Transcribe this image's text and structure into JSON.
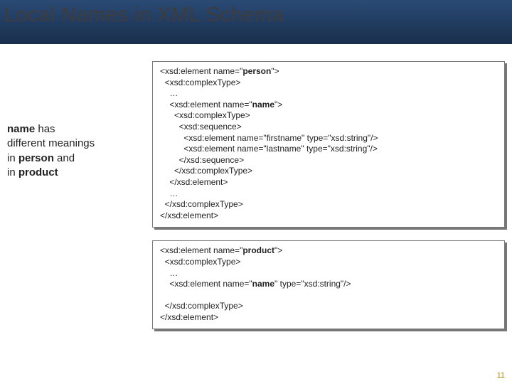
{
  "title": "Local Names in XML Schema",
  "left": {
    "t1": "name",
    "t2": " has",
    "t3": "different meanings",
    "t4": "in ",
    "t5": "person",
    "t6": " and",
    "t7": "in ",
    "t8": "product"
  },
  "code1": {
    "l1": "<xsd:element name=\"",
    "l1b": "person",
    "l1c": "\">",
    "l2": "  <xsd:complexType>",
    "l3": "    …",
    "l4": "    <xsd:element name=\"",
    "l4b": "name",
    "l4c": "\">",
    "l5": "      <xsd:complexType>",
    "l6": "        <xsd:sequence>",
    "l7": "          <xsd:element name=\"firstname\" type=\"xsd:string\"/>",
    "l8": "          <xsd:element name=\"lastname\" type=\"xsd:string\"/>",
    "l9": "        </xsd:sequence>",
    "l10": "      </xsd:complexType>",
    "l11": "    </xsd:element>",
    "l12": "    …",
    "l13": "  </xsd:complexType>",
    "l14": "</xsd:element>"
  },
  "code2": {
    "l1": "<xsd:element name=\"",
    "l1b": "product",
    "l1c": "\">",
    "l2": "  <xsd:complexType>",
    "l3": "    …",
    "l4": "    <xsd:element name=\"",
    "l4b": "name",
    "l4c": "\" type=\"xsd:string\"/>",
    "blank": "",
    "l5": "  </xsd:complexType>",
    "l6": "</xsd:element>"
  },
  "slide_number": "11"
}
